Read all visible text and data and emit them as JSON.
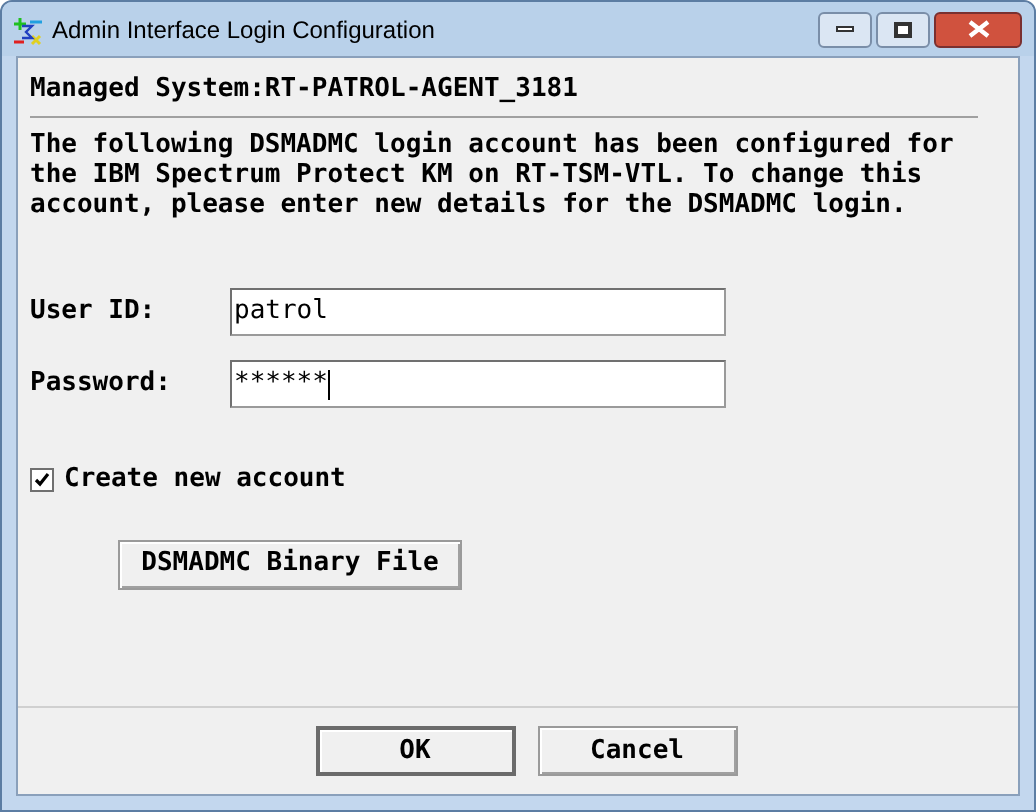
{
  "window": {
    "title": "Admin Interface Login Configuration"
  },
  "managed_system": "Managed System:RT-PATROL-AGENT_3181",
  "message": "The following DSMADMC login account has been configured for the IBM Spectrum Protect KM on RT-TSM-VTL. To change this account, please enter new details for the DSMADMC login.",
  "fields": [
    {
      "label": "User ID:",
      "value": "patrol"
    },
    {
      "label": "Password:",
      "value": "******"
    }
  ],
  "checkbox": {
    "label": "Create new account",
    "checked": true
  },
  "binary_button": "DSMADMC Binary File",
  "buttons": [
    {
      "label": "OK",
      "default": true
    },
    {
      "label": "Cancel",
      "default": false
    }
  ]
}
